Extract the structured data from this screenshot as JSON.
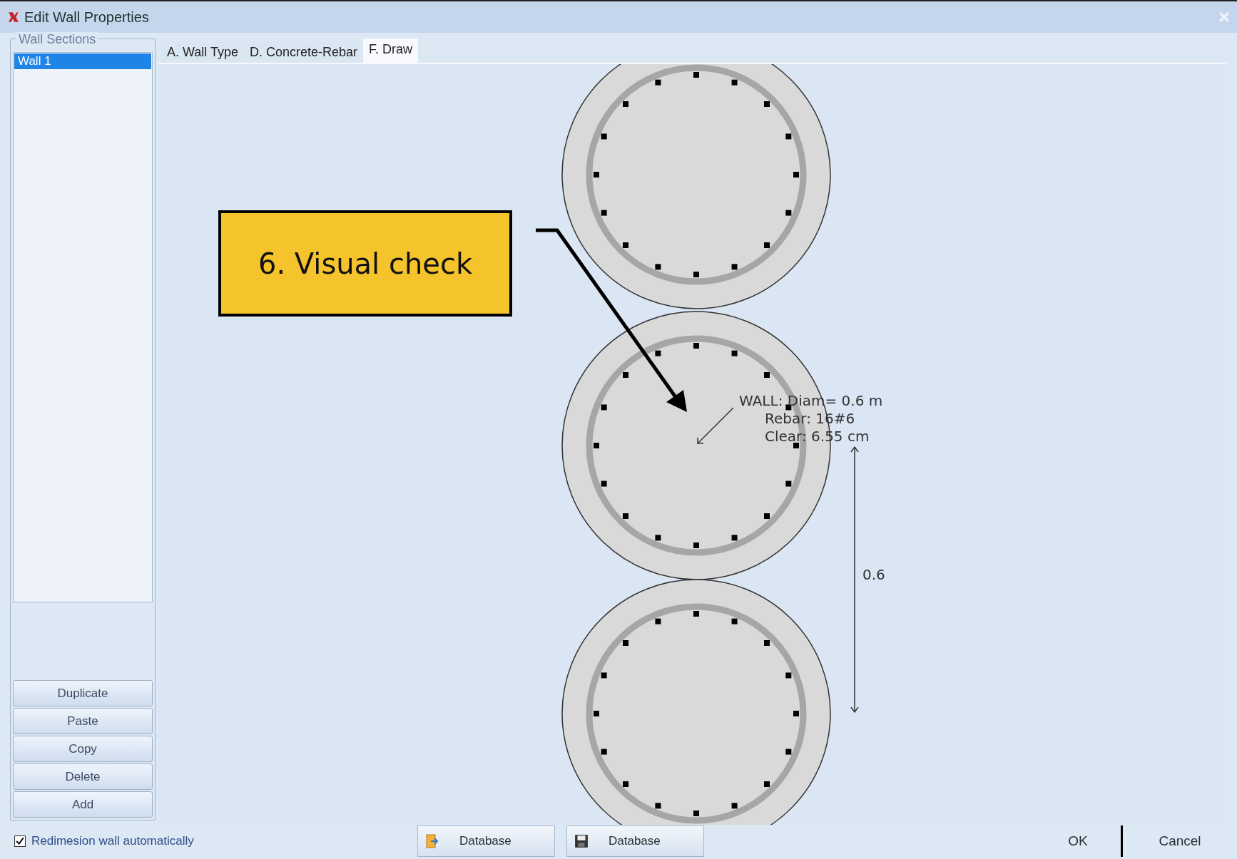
{
  "window": {
    "title": "Edit Wall Properties"
  },
  "sidebar": {
    "group_label": "Wall Sections",
    "items": [
      {
        "label": "Wall 1",
        "selected": true
      }
    ],
    "buttons": [
      "Duplicate",
      "Paste",
      "Copy",
      "Delete",
      "Add"
    ]
  },
  "tabs": [
    {
      "label": "A. Wall Type",
      "selected": false
    },
    {
      "label": "D. Concrete-Rebar",
      "selected": false
    },
    {
      "label": "F. Draw",
      "selected": true
    }
  ],
  "drawing": {
    "callout": "6. Visual check",
    "annotation": [
      "WALL: Diam= 0.6 m",
      "Rebar: 16#6",
      "Clear: 6.55 cm"
    ],
    "dimension": "0.6"
  },
  "footer": {
    "checkbox": {
      "label": "Redimesion wall automatically",
      "checked": true
    },
    "database_buttons": [
      {
        "label": "Database",
        "kind": "import"
      },
      {
        "label": "Database",
        "kind": "save"
      }
    ],
    "ok": "OK",
    "cancel": "Cancel"
  }
}
